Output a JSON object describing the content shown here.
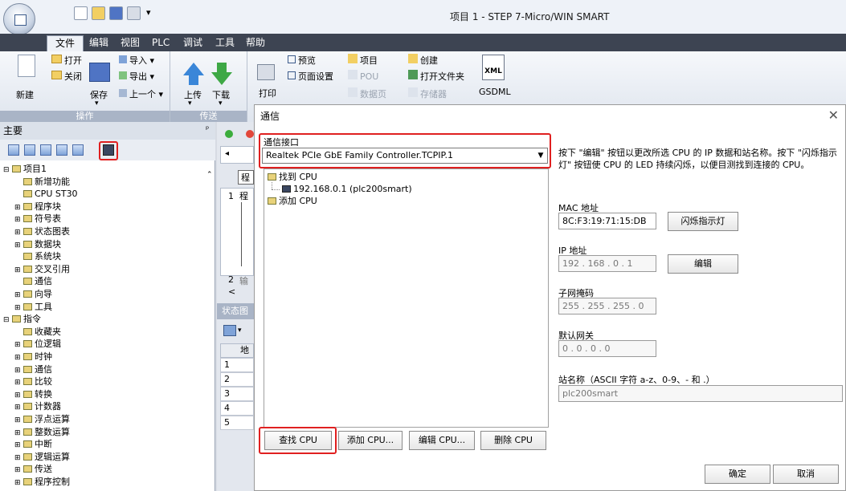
{
  "window": {
    "title": "项目 1 - STEP 7-Micro/WIN SMART"
  },
  "menu_tabs": [
    "文件",
    "编辑",
    "视图",
    "PLC",
    "调试",
    "工具",
    "帮助"
  ],
  "ribbon": {
    "operation": {
      "new": "新建",
      "open": "打开",
      "close": "关闭",
      "save": "保存",
      "import": "导入",
      "export": "导出",
      "previous": "上一个",
      "group": "操作"
    },
    "transfer": {
      "upload": "上传",
      "download": "下载",
      "group": "传送"
    },
    "print": {
      "print": "打印",
      "preview": "预览",
      "page_setup": "页面设置",
      "project": "项目",
      "pou": "POU",
      "data_page": "数据页",
      "create": "创建",
      "open_folder": "打开文件夹",
      "memory": "存储器",
      "gsdml_top": "XML",
      "gsdml": "GSDML"
    }
  },
  "left_panel": {
    "header": "主要",
    "pin": "ᵖ",
    "tree": [
      {
        "label": "项目1",
        "indent": 0,
        "toggle": "⊟"
      },
      {
        "label": "新增功能",
        "indent": 1,
        "toggle": ""
      },
      {
        "label": "CPU ST30",
        "indent": 1,
        "toggle": ""
      },
      {
        "label": "程序块",
        "indent": 1,
        "toggle": "⊞"
      },
      {
        "label": "符号表",
        "indent": 1,
        "toggle": "⊞"
      },
      {
        "label": "状态图表",
        "indent": 1,
        "toggle": "⊞"
      },
      {
        "label": "数据块",
        "indent": 1,
        "toggle": "⊞"
      },
      {
        "label": "系统块",
        "indent": 1,
        "toggle": ""
      },
      {
        "label": "交叉引用",
        "indent": 1,
        "toggle": "⊞"
      },
      {
        "label": "通信",
        "indent": 1,
        "toggle": ""
      },
      {
        "label": "向导",
        "indent": 1,
        "toggle": "⊞"
      },
      {
        "label": "工具",
        "indent": 1,
        "toggle": "⊞"
      },
      {
        "label": "指令",
        "indent": 0,
        "toggle": "⊟"
      },
      {
        "label": "收藏夹",
        "indent": 1,
        "toggle": ""
      },
      {
        "label": "位逻辑",
        "indent": 1,
        "toggle": "⊞"
      },
      {
        "label": "时钟",
        "indent": 1,
        "toggle": "⊞"
      },
      {
        "label": "通信",
        "indent": 1,
        "toggle": "⊞"
      },
      {
        "label": "比较",
        "indent": 1,
        "toggle": "⊞"
      },
      {
        "label": "转换",
        "indent": 1,
        "toggle": "⊞"
      },
      {
        "label": "计数器",
        "indent": 1,
        "toggle": "⊞"
      },
      {
        "label": "浮点运算",
        "indent": 1,
        "toggle": "⊞"
      },
      {
        "label": "整数运算",
        "indent": 1,
        "toggle": "⊞"
      },
      {
        "label": "中断",
        "indent": 1,
        "toggle": "⊞"
      },
      {
        "label": "逻辑运算",
        "indent": 1,
        "toggle": "⊞"
      },
      {
        "label": "传送",
        "indent": 1,
        "toggle": "⊞"
      },
      {
        "label": "程序控制",
        "indent": 1,
        "toggle": "⊞"
      }
    ]
  },
  "middle": {
    "prog_tab": "程",
    "prog_tab2": "程",
    "row1": "1",
    "row2": "2",
    "row2_text": "输",
    "status_header": "状态图",
    "addr_col": "地",
    "rows": [
      "1",
      "2",
      "3",
      "4",
      "5"
    ]
  },
  "dialog": {
    "title": "通信",
    "close": "✕",
    "interface_label": "通信接口",
    "interface_value": "Realtek PCIe GbE Family Controller.TCPIP.1",
    "tree_found": "找到 CPU",
    "tree_found_item": "192.168.0.1 (plc200smart)",
    "tree_add": "添加 CPU",
    "instructions": "按下 \"编辑\" 按钮以更改所选 CPU 的 IP 数据和站名称。按下 \"闪烁指示灯\" 按钮使 CPU 的 LED 持续闪烁，以便目测找到连接的 CPU。",
    "mac_label": "MAC 地址",
    "mac_value": "8C:F3:19:71:15:DB",
    "blink_button": "闪烁指示灯",
    "ip_label": "IP 地址",
    "ip_value": "192 . 168 .  0  .  1",
    "edit_button": "编辑",
    "subnet_label": "子网掩码",
    "subnet_value": "255 . 255 . 255 .  0",
    "gateway_label": "默认网关",
    "gateway_value": " 0  .  0  .  0  .  0",
    "station_label": "站名称（ASCII 字符 a-z、0-9、- 和 .）",
    "station_value": "plc200smart",
    "find_cpu": "查找 CPU",
    "add_cpu": "添加 CPU...",
    "edit_cpu": "编辑 CPU...",
    "delete_cpu": "删除 CPU",
    "ok": "确定",
    "cancel": "取消"
  },
  "colors": {
    "highlight": "#e02020",
    "tab_bar": "#3d4452"
  }
}
